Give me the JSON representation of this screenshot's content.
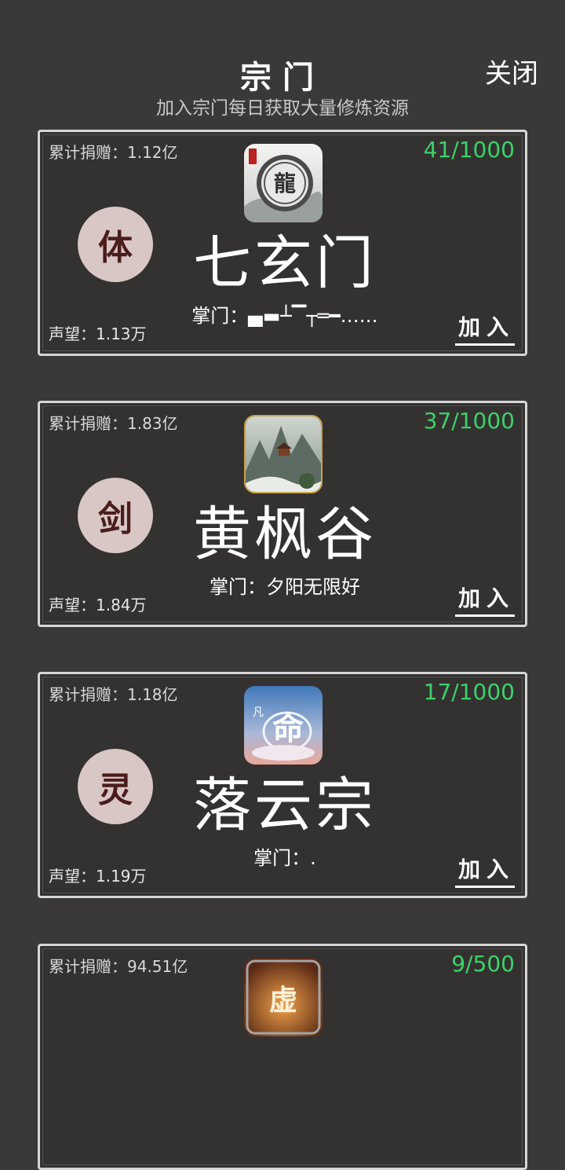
{
  "header": {
    "title": "宗门",
    "subtitle": "加入宗门每日获取大量修炼资源",
    "close_label": "关闭"
  },
  "sects": [
    {
      "donation": "累计捐赠：1.12亿",
      "members": "41/1000",
      "badge": "体",
      "name": "七玄门",
      "leader": "掌门：▄▬┴▔┬═━……",
      "prestige": "声望：1.13万",
      "join_label": "加入",
      "logo_icon": "dragon-medallion-logo-icon"
    },
    {
      "donation": "累计捐赠：1.83亿",
      "members": "37/1000",
      "badge": "剑",
      "name": "黄枫谷",
      "leader": "掌门：夕阳无限好",
      "prestige": "声望：1.84万",
      "join_label": "加入",
      "logo_icon": "mountain-temple-logo-icon"
    },
    {
      "donation": "累计捐赠：1.18亿",
      "members": "17/1000",
      "badge": "灵",
      "name": "落云宗",
      "leader": "掌门：.",
      "prestige": "声望：1.19万",
      "join_label": "加入",
      "logo_icon": "cloud-calligraphy-logo-icon"
    },
    {
      "donation": "累计捐赠：94.51亿",
      "members": "9/500",
      "badge": "",
      "name": "",
      "leader": "",
      "prestige": "",
      "join_label": "",
      "logo_icon": "fire-calligraphy-logo-icon"
    }
  ],
  "colors": {
    "background": "#3b3938",
    "card_border": "#d6d6d6",
    "members_green": "#3dd16a",
    "badge_bg": "#d8c7c5",
    "badge_text": "#4a1c1c"
  }
}
